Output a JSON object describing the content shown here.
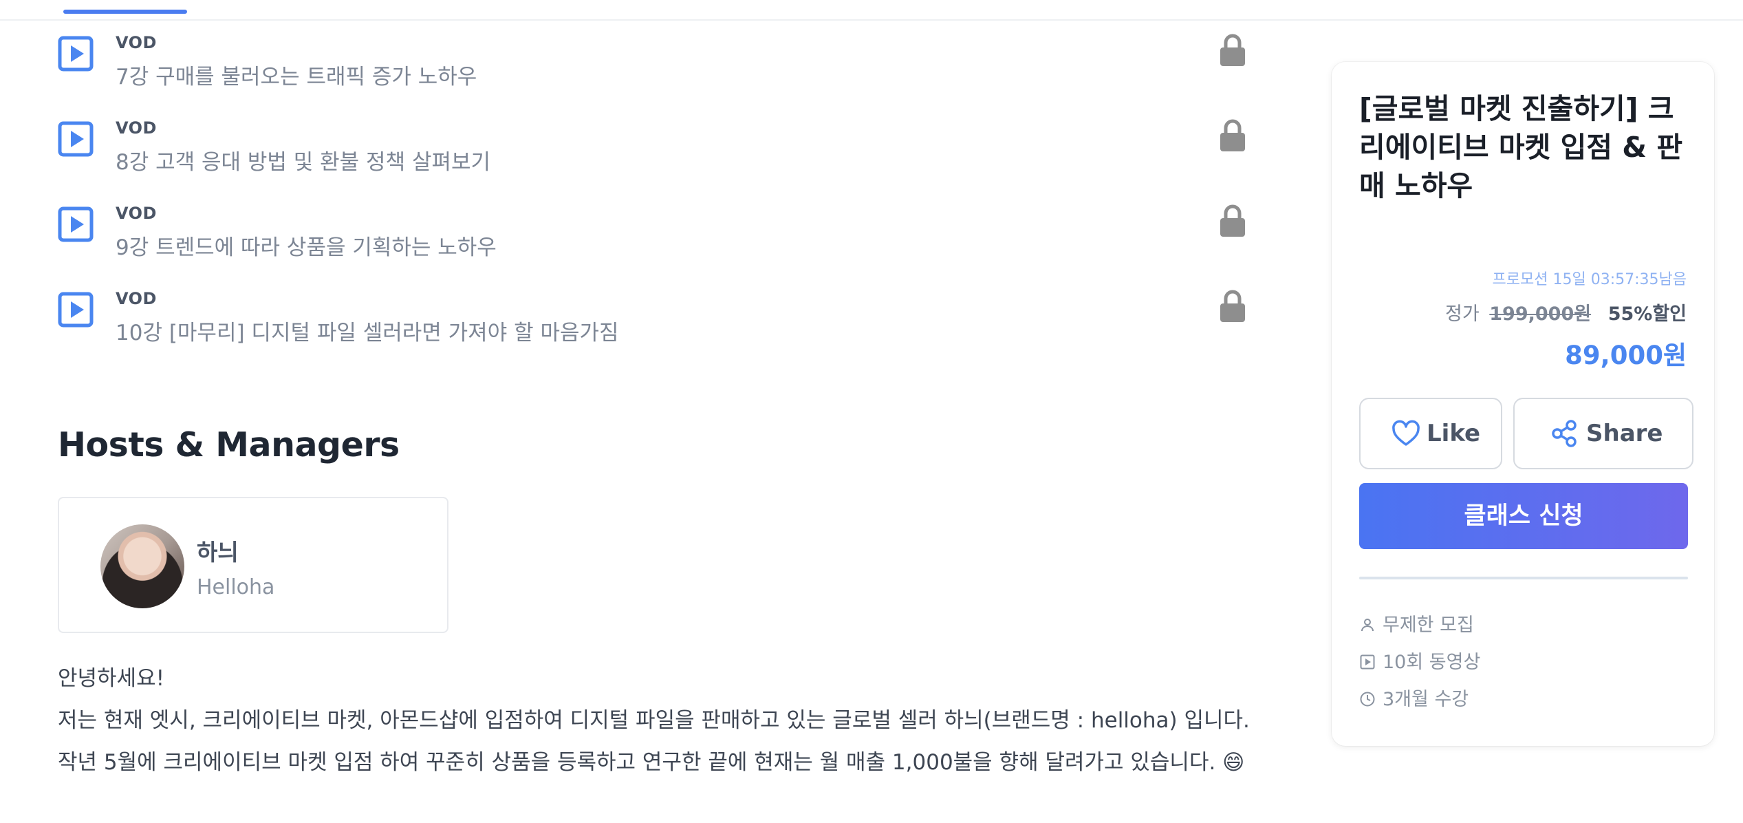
{
  "lessons": [
    {
      "type": "VOD",
      "title": "7강 구매를 불러오는 트래픽 증가 노하우"
    },
    {
      "type": "VOD",
      "title": "8강 고객 응대 방법 및 환불 정책 살펴보기"
    },
    {
      "type": "VOD",
      "title": "9강 트렌드에 따라 상품을 기획하는 노하우"
    },
    {
      "type": "VOD",
      "title": "10강 [마무리] 디지털 파일 셀러라면 가져야 할 마음가짐"
    }
  ],
  "hosts": {
    "heading": "Hosts & Managers",
    "host": {
      "name": "하늬",
      "subtitle": "Helloha"
    }
  },
  "intro": {
    "line1": "안녕하세요!",
    "line2": "저는 현재 엣시, 크리에이티브 마켓, 아몬드샵에 입점하여 디지털 파일을 판매하고 있는 글로벌 셀러 하늬(브랜드명 : helloha) 입니다.",
    "line3": "작년 5월에 크리에이티브 마켓 입점 하여 꾸준히 상품을 등록하고 연구한 끝에 현재는 월 매출 1,000불을 향해 달려가고 있습니다. 😄"
  },
  "sidebar": {
    "course_title": "[글로벌 마켓 진출하기] 크리에이티브 마켓 입점 & 판매 노하우",
    "promo": "프로모션 15일 03:57:35남음",
    "price_label": "정가",
    "original_price": "199,000원",
    "discount": "55%할인",
    "sale_price": "89,000원",
    "like_label": "Like",
    "share_label": "Share",
    "apply_label": "클래스 신청",
    "meta": {
      "recruit": "무제한 모집",
      "videos": "10회 동영상",
      "period": "3개월 수강"
    }
  },
  "colors": {
    "accent": "#4a86f0",
    "apply_gradient_start": "#4a74f2",
    "apply_gradient_end": "#6e68ec",
    "promo": "#8fb2f2"
  }
}
